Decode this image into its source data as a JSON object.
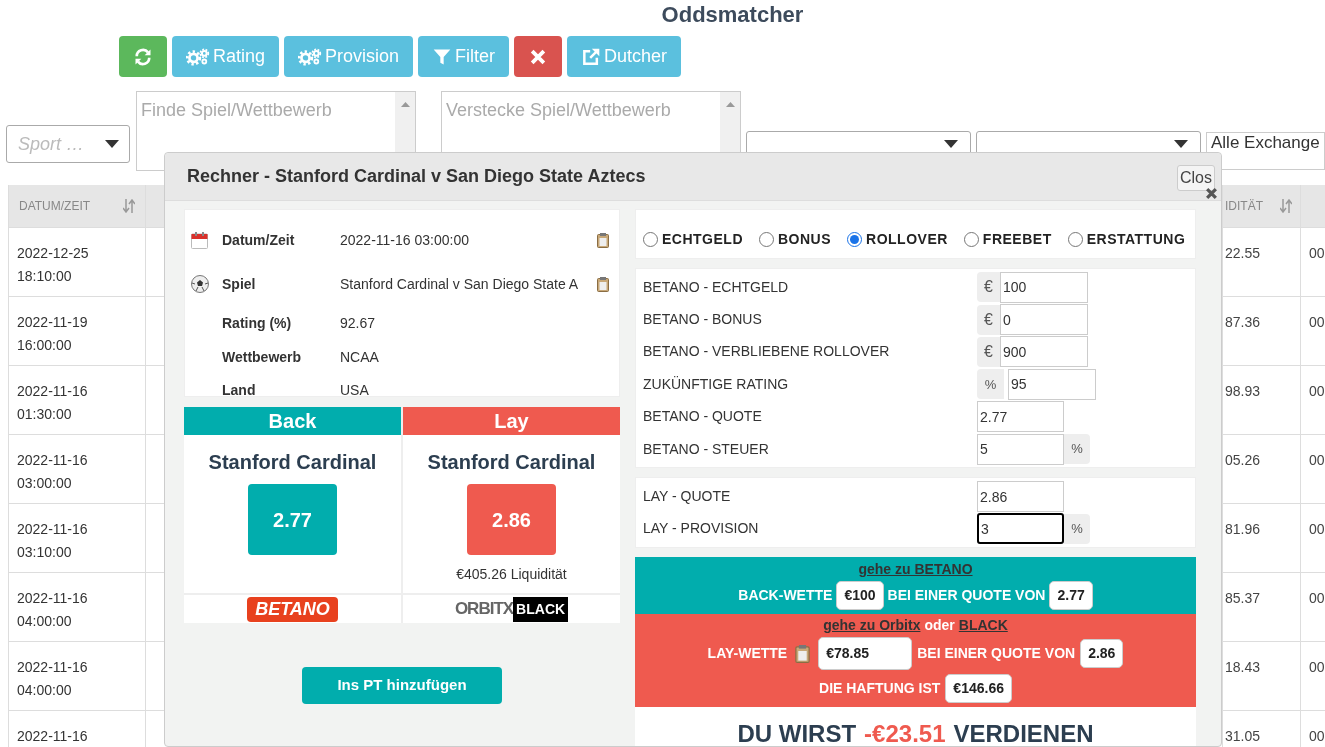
{
  "page_title": "Oddsmatcher",
  "toolbar": [
    {
      "kind": "refresh",
      "color": "#5cb85c"
    },
    {
      "kind": "gears",
      "label": "Rating",
      "color": "#5bc0de"
    },
    {
      "kind": "gears",
      "label": "Provision",
      "color": "#5bc0de"
    },
    {
      "kind": "filter",
      "label": "Filter",
      "color": "#5bc0de"
    },
    {
      "kind": "close",
      "color": "#d9534f"
    },
    {
      "kind": "external",
      "label": "Dutcher",
      "color": "#5bc0de"
    }
  ],
  "filters": {
    "sport": {
      "placeholder": "Sport …"
    },
    "find": {
      "placeholder": "Finde Spiel/Wettbewerb"
    },
    "hide": {
      "placeholder": "Verstecke Spiel/Wettbewerb"
    },
    "exchange": {
      "value": "Alle Exchange"
    }
  },
  "table": {
    "columns": [
      {
        "label": "DATUM/ZEIT",
        "sortable": true
      },
      {
        "label": "IDITÄT",
        "sortable": true
      }
    ],
    "rows": [
      {
        "date": "2022-12-25",
        "time": "18:10:00",
        "column_2": "22.55",
        "column_3": "00"
      },
      {
        "date": "2022-11-19",
        "time": "16:00:00",
        "column_2": "87.36",
        "column_3": "00"
      },
      {
        "date": "2022-11-16",
        "time": "01:30:00",
        "column_2": "98.93",
        "column_3": "00"
      },
      {
        "date": "2022-11-16",
        "time": "03:00:00",
        "column_2": "05.26",
        "column_3": "00"
      },
      {
        "date": "2022-11-16",
        "time": "03:10:00",
        "column_2": "81.96",
        "column_3": "00"
      },
      {
        "date": "2022-11-16",
        "time": "04:00:00",
        "column_2": "85.37",
        "column_3": "00"
      },
      {
        "date": "2022-11-16",
        "time": "04:00:00",
        "column_2": "18.43",
        "column_3": "00"
      },
      {
        "date": "2022-11-16",
        "column_2": "31.05",
        "column_3": "00"
      }
    ]
  },
  "modal": {
    "title": "Rechner - Stanford Cardinal v San Diego State Aztecs",
    "close_label": "Clos",
    "info": [
      {
        "kind": "date",
        "label": "Datum/Zeit",
        "value": "2022-11-16 03:00:00",
        "copyable": true
      },
      {
        "kind": "game",
        "label": "Spiel",
        "value": "Stanford Cardinal v San Diego State A",
        "copyable": true
      },
      {
        "kind": "plain",
        "label": "Rating (%)",
        "value": "92.67",
        "copyable": false
      },
      {
        "kind": "plain",
        "label": "Wettbewerb",
        "value": "NCAA",
        "copyable": false
      },
      {
        "kind": "plain",
        "label": "Land",
        "value": "USA",
        "copyable": false
      }
    ],
    "back": {
      "header": "Back",
      "team": "Stanford Cardinal",
      "odds": "2.77",
      "logo": [
        "BETANO"
      ]
    },
    "lay": {
      "header": "Lay",
      "team": "Stanford Cardinal",
      "odds": "2.86",
      "liquidity": "€405.26 Liquidität",
      "logo": [
        "ORBITX",
        "BLACK"
      ]
    },
    "add_button": "Ins PT hinzufügen",
    "bet_types": [
      {
        "label": "ECHTGELD",
        "selected": false
      },
      {
        "label": "BONUS",
        "selected": false
      },
      {
        "label": "ROLLOVER",
        "selected": true
      },
      {
        "label": "FREEBET",
        "selected": false
      },
      {
        "label": "ERSTATTUNG",
        "selected": false
      }
    ],
    "inputs": [
      {
        "label": "BETANO - ECHTGELD",
        "value": "100",
        "prefix": "€",
        "focused": false
      },
      {
        "label": "BETANO - BONUS",
        "value": "0",
        "prefix": "€",
        "focused": false
      },
      {
        "label": "BETANO - VERBLIEBENE ROLLOVER",
        "value": "900",
        "prefix": "€",
        "focused": false
      },
      {
        "label": "ZUKÜNFTIGE RATING",
        "value": "95",
        "prefix": "%",
        "focused": false
      },
      {
        "label": "BETANO - QUOTE",
        "value": "2.77",
        "focused": false
      },
      {
        "label": "BETANO - STEUER",
        "value": "5",
        "suffix": "%",
        "focused": false
      }
    ],
    "lay_inputs": [
      {
        "label": "LAY - QUOTE",
        "value": "2.86",
        "focused": false
      },
      {
        "label": "LAY - PROVISION",
        "value": "3",
        "suffix": "%",
        "focused": true
      }
    ],
    "result": {
      "back_link": "gehe zu BETANO",
      "back_label": "BACK-WETTE",
      "back_stake": "€100",
      "back_odds_label": "BEI EINER QUOTE VON",
      "back_odds": "2.77",
      "lay_link": "gehe zu  Orbitx",
      "lay_or": "oder",
      "lay_link_2": "BLACK",
      "lay_label": "LAY-WETTE",
      "lay_stake": "€78.85",
      "lay_odds_label": "BEI EINER QUOTE VON",
      "lay_odds": "2.86",
      "liability_label": "DIE HAFTUNG IST",
      "liability": "€146.66",
      "profit_prefix": "DU WIRST",
      "profit_amount": "-€23.51",
      "profit_suffix": "VERDIENEN"
    }
  }
}
